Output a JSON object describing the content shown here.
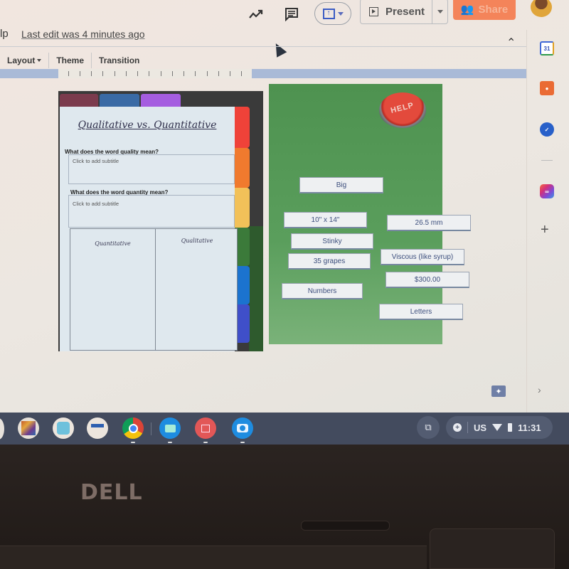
{
  "header": {
    "menu_fragment": "lp",
    "last_edit": "Last edit was 4 minutes ago",
    "present_label": "Present",
    "share_label": "Share",
    "icons": [
      "activity-trend-icon",
      "comment-icon",
      "new-slide-icon",
      "present-icon",
      "share-people-icon",
      "avatar"
    ]
  },
  "toolbar": {
    "items": [
      {
        "label": "Layout",
        "has_dropdown": true
      },
      {
        "label": "Theme",
        "has_dropdown": false
      },
      {
        "label": "Transition",
        "has_dropdown": false
      }
    ]
  },
  "side_panel": {
    "calendar_label": "31",
    "icons": [
      "calendar-icon",
      "keep-icon",
      "tasks-icon",
      "creative-cloud-icon",
      "add-addon-icon"
    ],
    "add_label": "+"
  },
  "slide_left": {
    "title": "Qualitative vs. Quantitative",
    "question1": "What does the word quality mean?",
    "answer1_placeholder": "Click to add subtitle",
    "question2": "What does the word quantity mean?",
    "answer2_placeholder": "Click to add subtitle",
    "tchart_headers": [
      "Quantitative",
      "Qualitative"
    ],
    "tab_colors": {
      "top": [
        "#7b3b4d",
        "#3a6aa5",
        "#a55de0"
      ],
      "side": [
        "#ef4239",
        "#f07a2e",
        "#f2c159",
        "#3b7a3a",
        "#1b73cf",
        "#3f4fc9"
      ]
    }
  },
  "slide_right": {
    "help_label": "HELP",
    "cards": [
      "Big",
      "10\" x 14\"",
      "26.5 mm",
      "Stinky",
      "35 grapes",
      "Viscous (like syrup)",
      "$300.00",
      "Numbers",
      "Letters"
    ]
  },
  "slide_controls": {
    "explore_icon": "explore-icon",
    "next_icon": "›"
  },
  "shelf": {
    "apps": [
      "books-app",
      "cloud-app",
      "teacher-app",
      "chrome",
      "files",
      "gallery",
      "camera"
    ],
    "locale": "US",
    "time": "11:31"
  },
  "device": {
    "brand": "DELL"
  }
}
